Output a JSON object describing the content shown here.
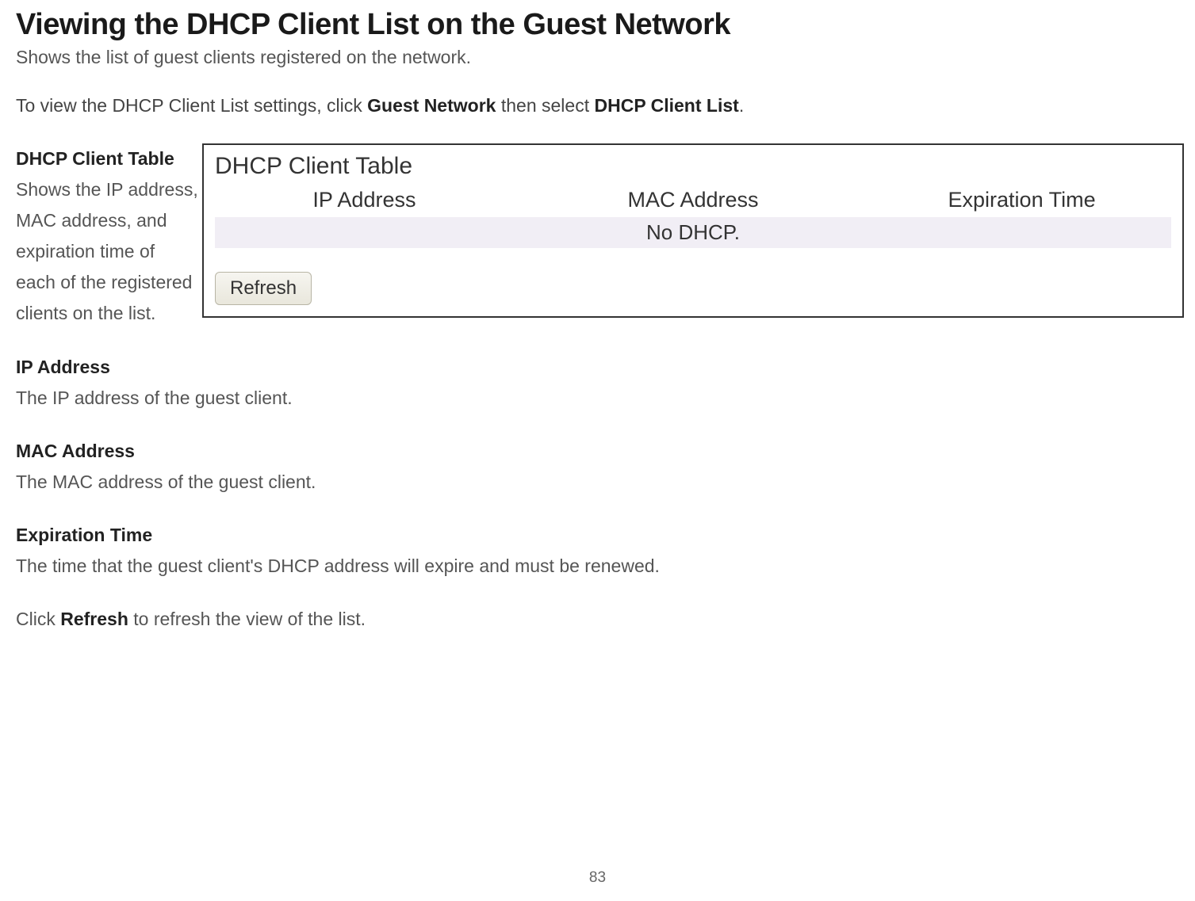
{
  "page": {
    "title": "Viewing the DHCP Client List on the Guest Network",
    "subtitle": "Shows the list of guest clients registered on the network.",
    "instruction_pre": "To view the DHCP Client List settings, click ",
    "instruction_bold1": "Guest Network",
    "instruction_mid": " then select ",
    "instruction_bold2": "DHCP Client List",
    "instruction_post": ".",
    "page_number": "83"
  },
  "terms": {
    "dhcp_client_table": {
      "title": "DHCP Client Table",
      "desc": "Shows the IP address, MAC address, and expiration time of each of the registered clients on the list."
    },
    "ip_address": {
      "title": "IP Address",
      "desc": "The IP address of the guest client."
    },
    "mac_address": {
      "title": "MAC Address",
      "desc": "The MAC address of the guest client."
    },
    "expiration_time": {
      "title": "Expiration Time",
      "desc": "The time that the guest client's DHCP address will expire and must be renewed."
    }
  },
  "footer": {
    "pre": "Click ",
    "bold": "Refresh",
    "post": " to refresh the view of the list."
  },
  "panel": {
    "title": "DHCP Client Table",
    "columns": {
      "ip": "IP Address",
      "mac": "MAC Address",
      "exp": "Expiration Time"
    },
    "empty_message": "No DHCP.",
    "refresh_label": "Refresh"
  }
}
